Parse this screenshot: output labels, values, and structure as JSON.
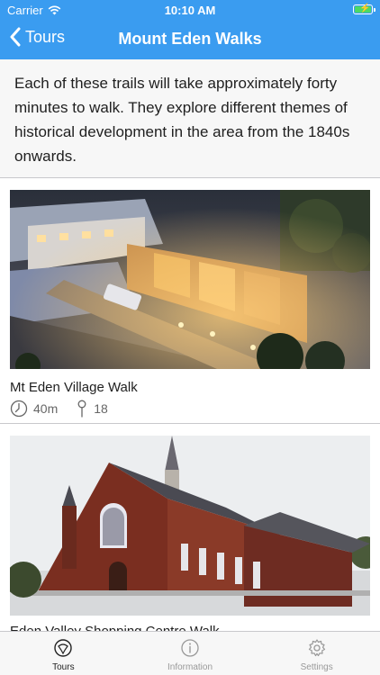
{
  "status_bar": {
    "carrier": "Carrier",
    "time": "10:10 AM"
  },
  "nav": {
    "back_label": "Tours",
    "title": "Mount Eden Walks"
  },
  "intro": {
    "text": "Each of these trails will take approximately forty minutes to walk. They explore different themes of historical development in the area from the 1840s onwards."
  },
  "tours": [
    {
      "title": "Mt Eden Village Walk",
      "duration": "40m",
      "stops": "18"
    },
    {
      "title": "Eden Valley Shopping Centre Walk"
    }
  ],
  "tab_bar": {
    "tabs": [
      {
        "label": "Tours",
        "icon": "compass-icon",
        "active": true
      },
      {
        "label": "Information",
        "icon": "info-icon",
        "active": false
      },
      {
        "label": "Settings",
        "icon": "gear-icon",
        "active": false
      }
    ]
  },
  "colors": {
    "accent": "#3a9cf0",
    "battery": "#4cd964"
  }
}
